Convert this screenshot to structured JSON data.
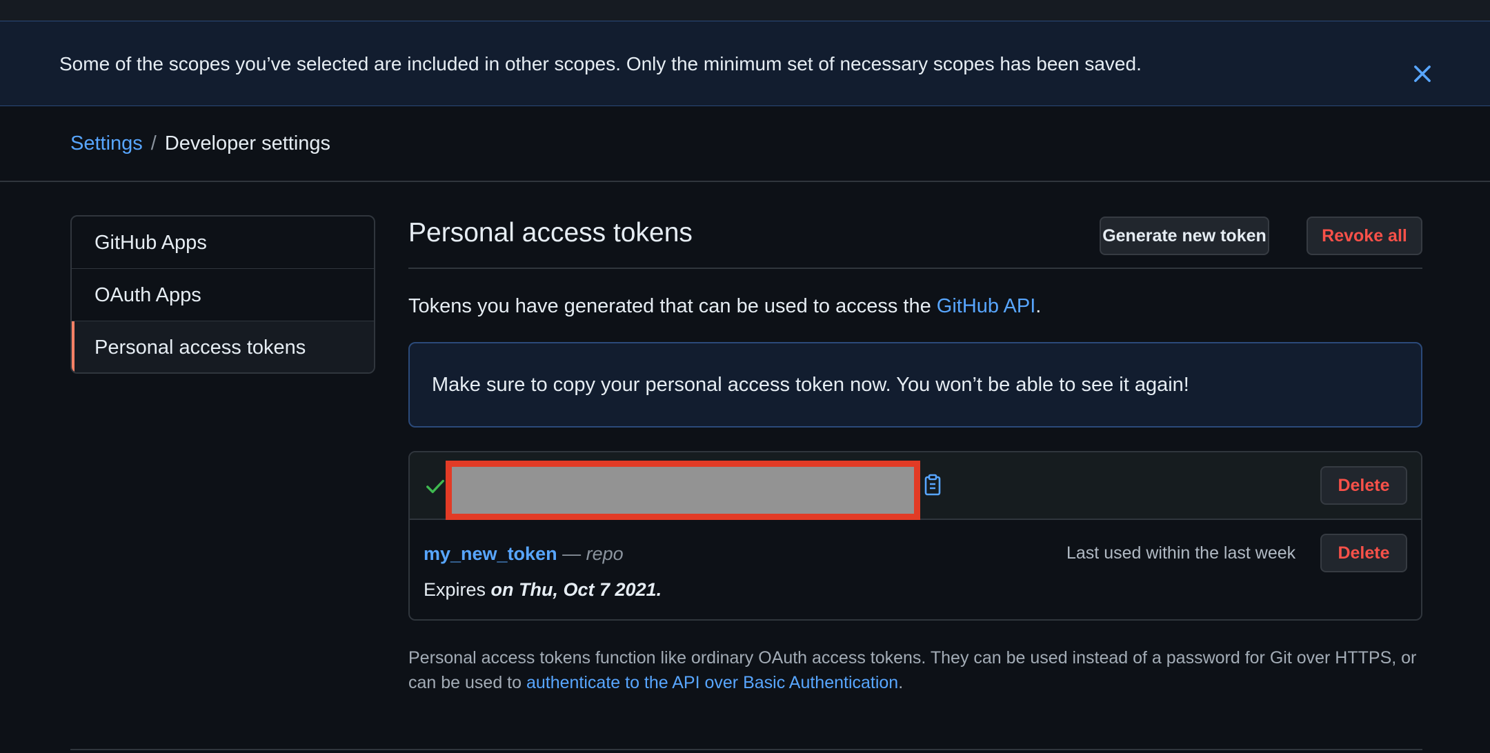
{
  "flash": {
    "message": "Some of the scopes you’ve selected are included in other scopes. Only the minimum set of necessary scopes has been saved.",
    "close_icon": "close-icon"
  },
  "breadcrumb": {
    "settings": "Settings",
    "separator": "/",
    "current": "Developer settings"
  },
  "sidebar": {
    "items": [
      {
        "label": "GitHub Apps",
        "selected": false
      },
      {
        "label": "OAuth Apps",
        "selected": false
      },
      {
        "label": "Personal access tokens",
        "selected": true
      }
    ]
  },
  "main": {
    "title": "Personal access tokens",
    "generate_button": "Generate new token",
    "revoke_button": "Revoke all",
    "intro_text": "Tokens you have generated that can be used to access the ",
    "intro_link": "GitHub API",
    "intro_end": ".",
    "notice": "Make sure to copy your personal access token now. You won’t be able to see it again!"
  },
  "tokens": {
    "new_token": {
      "check_icon": "check-icon",
      "copy_icon": "clipboard-icon",
      "delete_label": "Delete"
    },
    "items": [
      {
        "name": "my_new_token",
        "dash": "—",
        "scope": "repo",
        "last_used": "Last used within the last week",
        "delete_label": "Delete",
        "expires_prefix": "Expires",
        "expires_date": "on Thu, Oct 7 2021."
      }
    ]
  },
  "footer": {
    "text1": "Personal access tokens function like ordinary OAuth access tokens. They can be used instead of a password for Git over HTTPS, or can be used to ",
    "link": "authenticate to the API over Basic Authentication",
    "text2": "."
  },
  "colors": {
    "background": "#0d1117",
    "link": "#58a6ff",
    "danger": "#f85149",
    "selected_accent": "#f78166",
    "success": "#3fb950"
  }
}
